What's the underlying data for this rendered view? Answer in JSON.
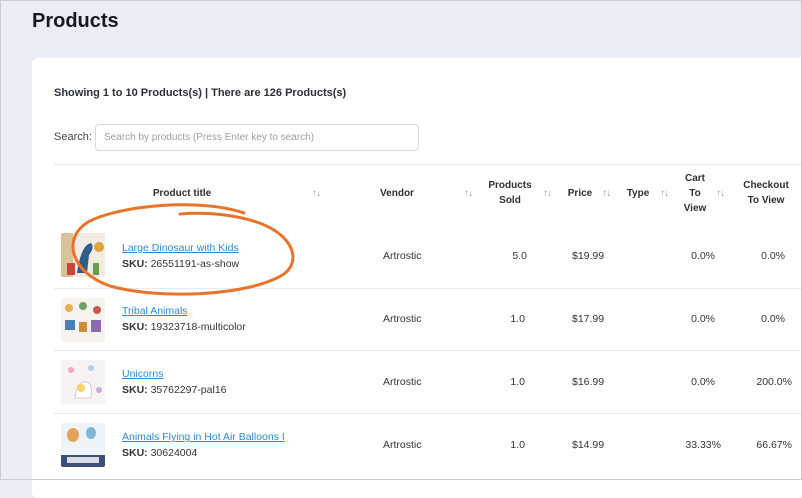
{
  "page": {
    "title": "Products"
  },
  "summary": {
    "showing_text": "Showing 1 to 10 Products(s) | There are 126 Products(s)"
  },
  "search": {
    "label": "Search:",
    "placeholder": "Search by products (Press Enter key to search)",
    "value": ""
  },
  "table": {
    "headers": {
      "product_title": "Product title",
      "vendor": "Vendor",
      "products_sold": [
        "Products",
        "Sold"
      ],
      "price": "Price",
      "type": "Type",
      "cart_to_view": [
        "Cart",
        "To",
        "View"
      ],
      "checkout_to_view": [
        "Checkout",
        "To View"
      ]
    },
    "sort_glyph": "↑↓",
    "sku_label": "SKU:",
    "rows": [
      {
        "title": "Large Dinosaur with Kids",
        "sku": "26551191-as-show",
        "vendor": "Artrostic",
        "sold": "5.0",
        "price": "$19.99",
        "type": "",
        "cart_to_view": "0.0%",
        "checkout_to_view": "0.0%"
      },
      {
        "title": "Tribal Animals",
        "sku": "19323718-multicolor",
        "vendor": "Artrostic",
        "sold": "1.0",
        "price": "$17.99",
        "type": "",
        "cart_to_view": "0.0%",
        "checkout_to_view": "0.0%"
      },
      {
        "title": "Unicorns",
        "sku": "35762297-pal16",
        "vendor": "Artrostic",
        "sold": "1.0",
        "price": "$16.99",
        "type": "",
        "cart_to_view": "0.0%",
        "checkout_to_view": "200.0%"
      },
      {
        "title": "Animals Flying in Hot Air Balloons I",
        "sku": "30624004",
        "vendor": "Artrostic",
        "sold": "1.0",
        "price": "$14.99",
        "type": "",
        "cart_to_view": "33.33%",
        "checkout_to_view": "66.67%"
      }
    ]
  },
  "colors": {
    "link": "#2a8ad8",
    "annotation": "#e8742c",
    "background": "#e9eef6"
  }
}
